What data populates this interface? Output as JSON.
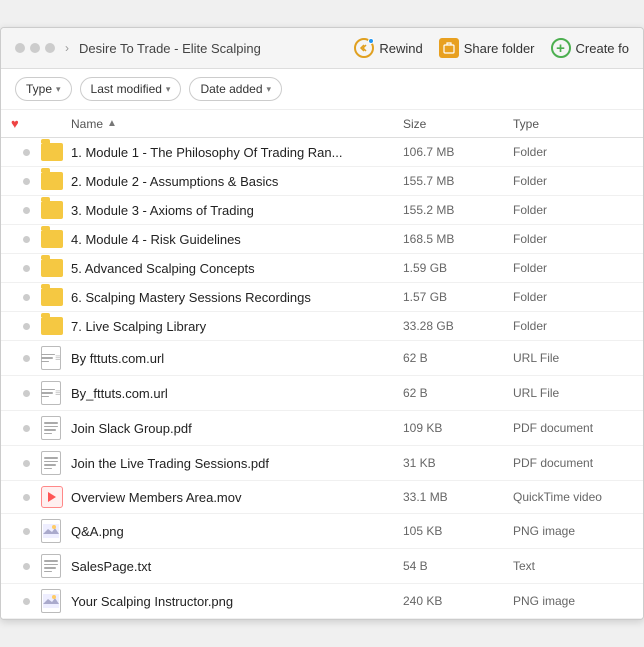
{
  "window": {
    "breadcrumb": "Desire To Trade - Elite Scalping",
    "actions": {
      "rewind": "Rewind",
      "share": "Share folder",
      "create": "Create fo"
    }
  },
  "filters": {
    "type_label": "Type",
    "modified_label": "Last modified",
    "date_label": "Date added"
  },
  "table": {
    "col_name": "Name",
    "col_size": "Size",
    "col_type": "Type"
  },
  "files": [
    {
      "name": "1. Module 1 - The Philosophy Of Trading Ran...",
      "size": "106.7 MB",
      "type": "Folder",
      "icon": "folder"
    },
    {
      "name": "2. Module 2 - Assumptions & Basics",
      "size": "155.7 MB",
      "type": "Folder",
      "icon": "folder"
    },
    {
      "name": "3. Module 3 - Axioms of Trading",
      "size": "155.2 MB",
      "type": "Folder",
      "icon": "folder"
    },
    {
      "name": "4. Module 4 - Risk Guidelines",
      "size": "168.5 MB",
      "type": "Folder",
      "icon": "folder"
    },
    {
      "name": "5. Advanced Scalping Concepts",
      "size": "1.59 GB",
      "type": "Folder",
      "icon": "folder"
    },
    {
      "name": "6. Scalping Mastery Sessions Recordings",
      "size": "1.57 GB",
      "type": "Folder",
      "icon": "folder"
    },
    {
      "name": "7. Live Scalping Library",
      "size": "33.28 GB",
      "type": "Folder",
      "icon": "folder"
    },
    {
      "name": "By fttuts.com.url",
      "size": "62 B",
      "type": "URL File",
      "icon": "url"
    },
    {
      "name": "By_fttuts.com.url",
      "size": "62 B",
      "type": "URL File",
      "icon": "url"
    },
    {
      "name": "Join Slack Group.pdf",
      "size": "109 KB",
      "type": "PDF document",
      "icon": "pdf"
    },
    {
      "name": "Join the Live Trading Sessions.pdf",
      "size": "31 KB",
      "type": "PDF document",
      "icon": "pdf"
    },
    {
      "name": "Overview Members Area.mov",
      "size": "33.1 MB",
      "type": "QuickTime video",
      "icon": "mov"
    },
    {
      "name": "Q&A.png",
      "size": "105 KB",
      "type": "PNG image",
      "icon": "png"
    },
    {
      "name": "SalesPage.txt",
      "size": "54 B",
      "type": "Text",
      "icon": "txt"
    },
    {
      "name": "Your Scalping Instructor.png",
      "size": "240 KB",
      "type": "PNG image",
      "icon": "png"
    }
  ]
}
